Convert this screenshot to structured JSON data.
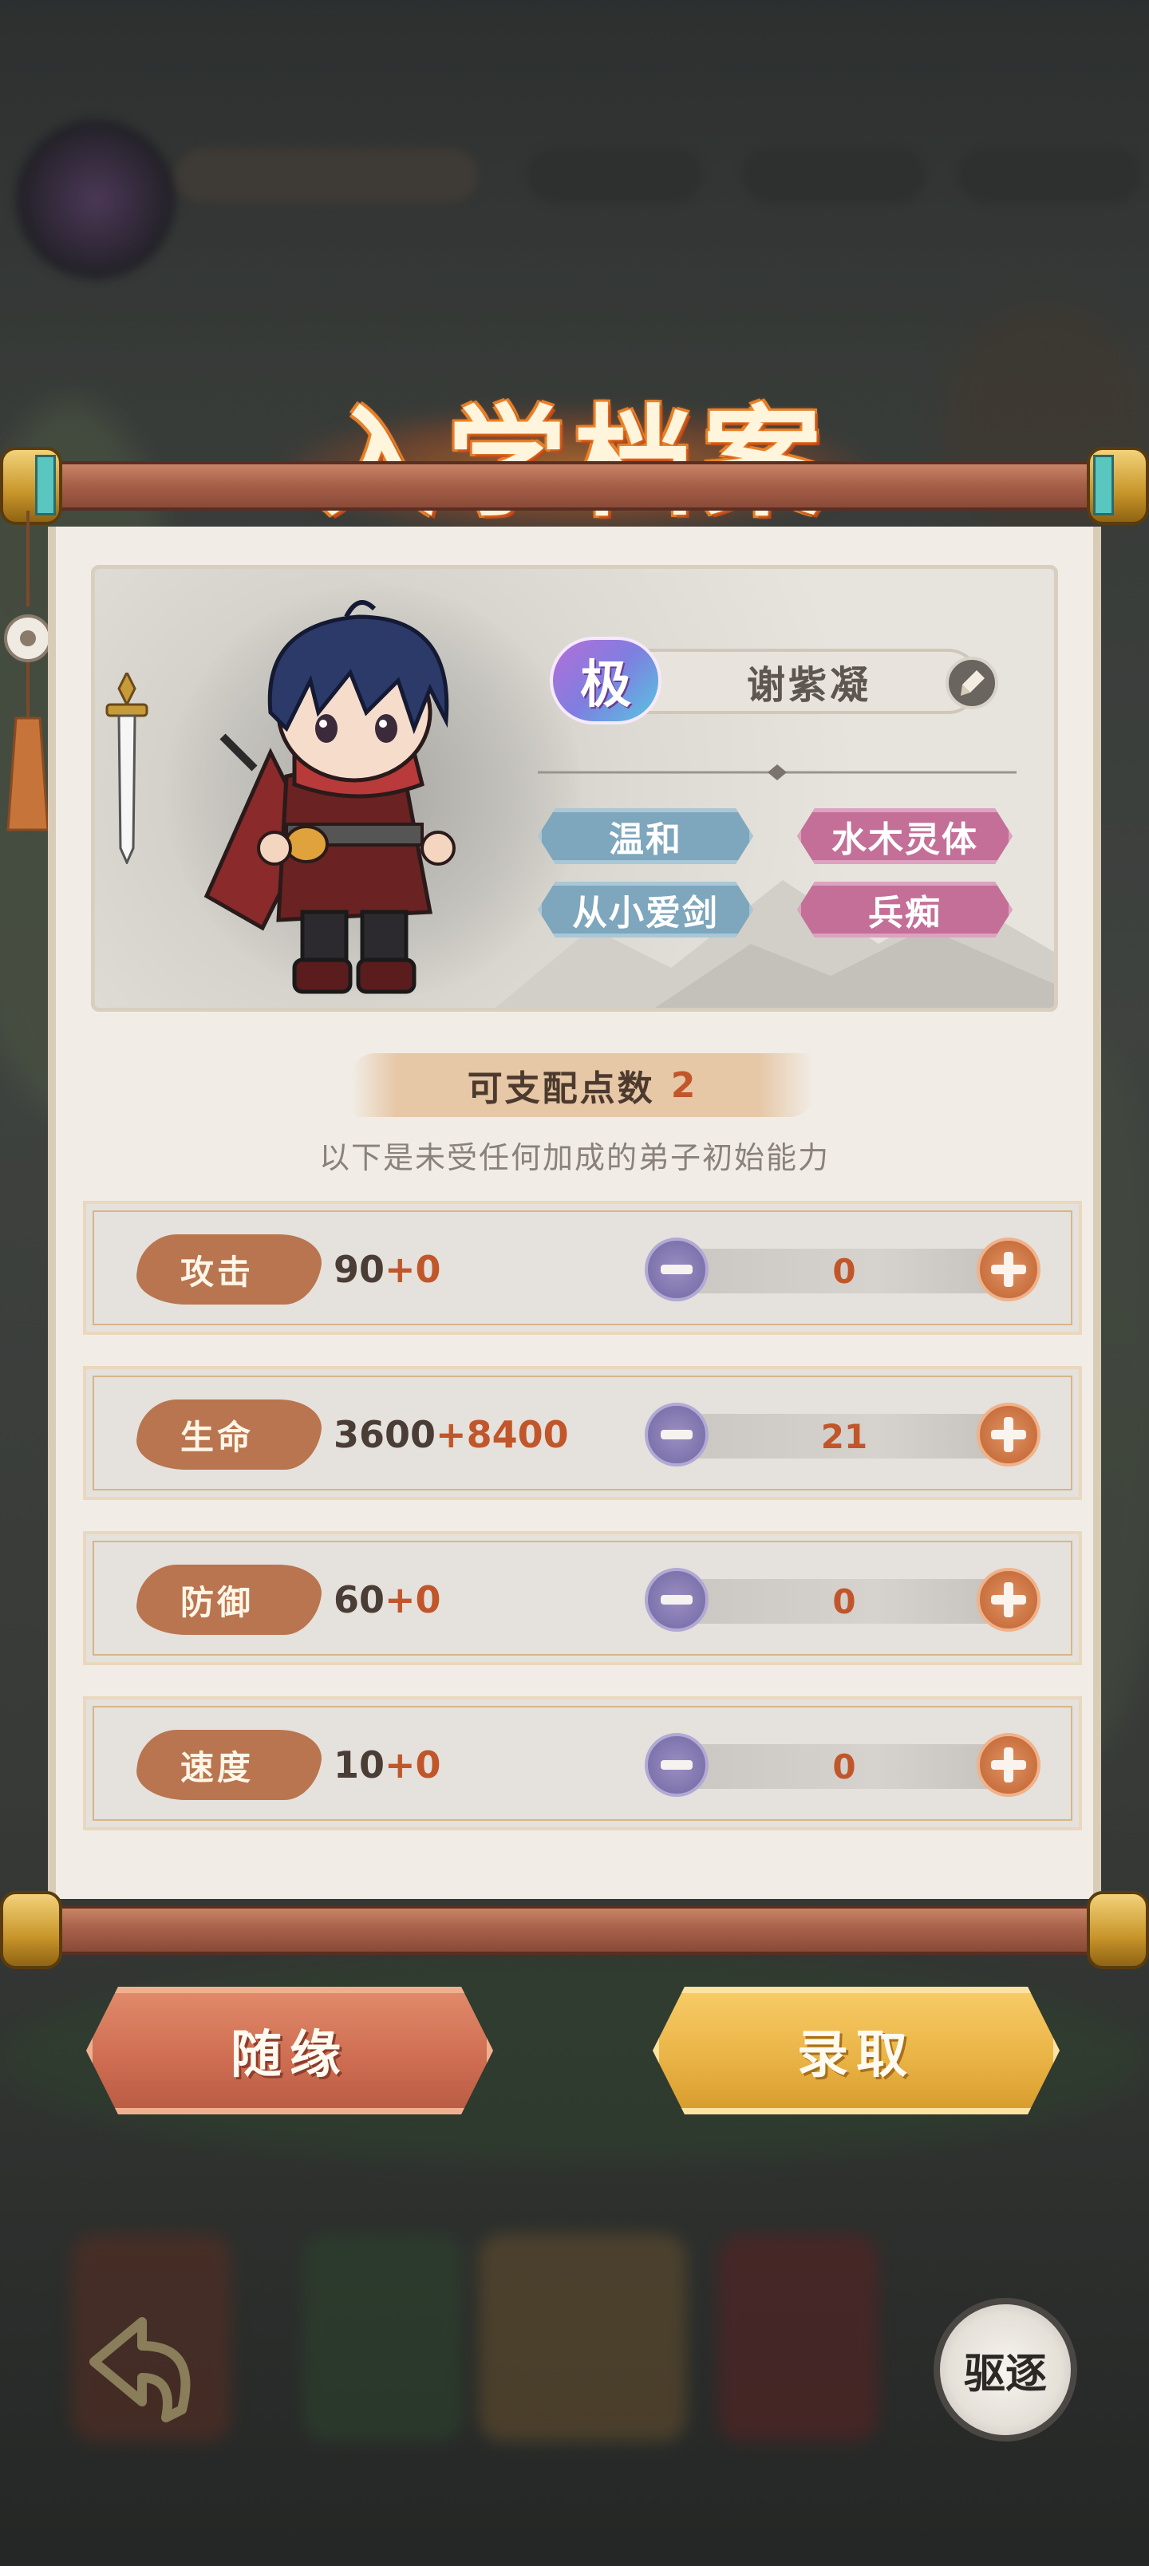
{
  "title": "入学档案",
  "character": {
    "rank": "极",
    "name": "谢紫凝",
    "traits": [
      {
        "label": "温和",
        "color": "blue"
      },
      {
        "label": "水木灵体",
        "color": "pink"
      },
      {
        "label": "从小爱剑",
        "color": "blue"
      },
      {
        "label": "兵痴",
        "color": "pink"
      }
    ]
  },
  "points": {
    "label": "可支配点数",
    "value": "2"
  },
  "subtitle": "以下是未受任何加成的弟子初始能力",
  "stats": [
    {
      "label": "攻击",
      "base": "90",
      "bonus": "+0",
      "alloc": "0"
    },
    {
      "label": "生命",
      "base": "3600",
      "bonus": "+8400",
      "alloc": "21"
    },
    {
      "label": "防御",
      "base": "60",
      "bonus": "+0",
      "alloc": "0"
    },
    {
      "label": "速度",
      "base": "10",
      "bonus": "+0",
      "alloc": "0"
    }
  ],
  "actions": {
    "random": "随缘",
    "admit": "录取",
    "expel": "驱逐"
  },
  "colors": {
    "accent": "#c1562a",
    "minus": "#7e74ad",
    "plus": "#c9703e",
    "tag_blue": "#7ea6bc",
    "tag_pink": "#c46f98"
  }
}
